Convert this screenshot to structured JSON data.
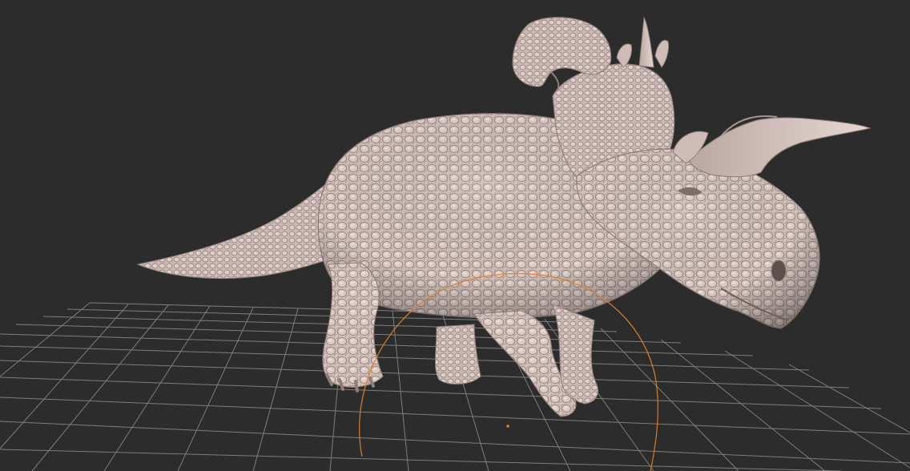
{
  "viewport": {
    "background": "#2c2c2c",
    "grid_color": "#8c8c8c",
    "model_color": "#d4c2bd",
    "gizmo_color": "#e0802a",
    "model": "triceratops-sculpt",
    "gizmo": "rotate-ring"
  }
}
